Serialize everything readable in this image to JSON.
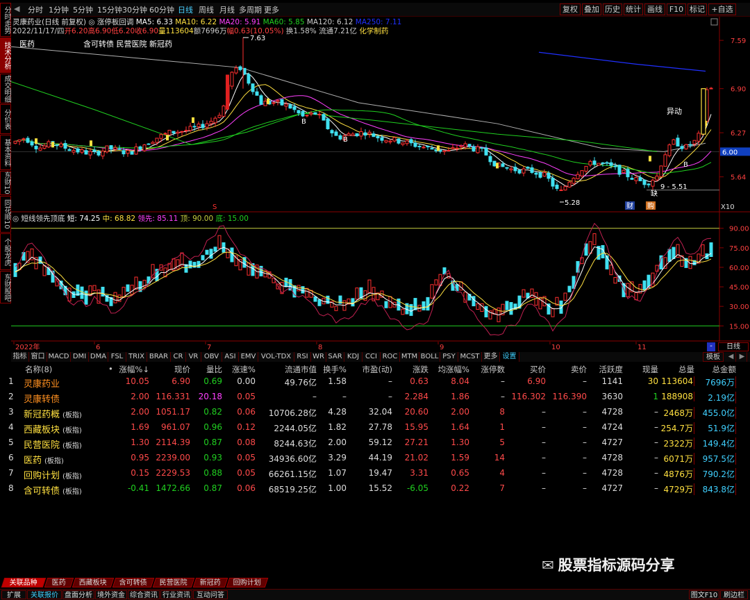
{
  "toolbar": {
    "periods": [
      "分时",
      "1分钟",
      "5分钟",
      "15分钟",
      "30分钟",
      "60分钟",
      "日线",
      "周线",
      "月线",
      "多周期",
      "更多"
    ],
    "active": "日线",
    "buttons": [
      "复权",
      "叠加",
      "历史",
      "统计",
      "画线",
      "F10",
      "标记",
      "+自选"
    ],
    "nav_back": "◀",
    "nav_fwd": "▶"
  },
  "left_tabs": [
    "分时走势",
    "技术分析",
    "成交明细",
    "分价表",
    "基本资料",
    "东财10",
    "同花顺10",
    "个股龙虎",
    "东财股吧"
  ],
  "left_tabs_active": 1,
  "chart_header": {
    "stock": "灵康药业(日线 前复权)",
    "indicator": "涨停板回调",
    "ma5": "MA5: 6.33",
    "ma10": "MA10: 6.22",
    "ma20": "MA20: 5.91",
    "ma60": "MA60: 5.85",
    "ma120": "MA120: 6.12",
    "ma250": "MA250: 7.11",
    "date": "2022/11/17/四",
    "open": "开6.20",
    "high": "高6.90",
    "low": "低6.20",
    "close": "收6.90",
    "vol": "量113604",
    "amount": "额7696万",
    "change": "幅0.63(10.05%)",
    "turnover": "换1.58%",
    "float": "流通7.21亿",
    "industry": "化学制药",
    "label_left": "医药",
    "label_concepts": "含可转债 民营医院 新冠药"
  },
  "price_axis": [
    "7.59",
    "6.90",
    "6.27",
    "5.64"
  ],
  "current_price": "6.00",
  "annotations": {
    "high": "7.63",
    "low": "5.28",
    "low2": "5.51",
    "low2_prefix": "9 -",
    "yidong": "异动",
    "cai": "财",
    "gou": "购",
    "que": "缺",
    "s": "S",
    "b1": "B",
    "b2": "B",
    "b3": "B",
    "x10": "X10"
  },
  "osc_header": {
    "name": "短线领先顶底",
    "short": "短: 74.25",
    "mid": "中: 68.82",
    "lead": "领先: 85.11",
    "top": "顶: 90.00",
    "bottom": "底: 15.00"
  },
  "osc_axis": [
    "90.00",
    "75.00",
    "60.00",
    "45.00",
    "30.00",
    "15.00"
  ],
  "date_axis": {
    "labels": [
      "2022年",
      "6",
      "7",
      "8",
      "9",
      "10",
      "11"
    ],
    "right_btn": "日线",
    "minus": "-"
  },
  "indicator_tabs": [
    "指标",
    "窗口",
    "MACD",
    "DMI",
    "DMA",
    "FSL",
    "TRIX",
    "BRAR",
    "CR",
    "VR",
    "OBV",
    "ASI",
    "EMV",
    "VOL-TDX",
    "RSI",
    "WR",
    "SAR",
    "KDJ",
    "CCI",
    "ROC",
    "MTM",
    "BOLL",
    "PSY",
    "MCST",
    "更多",
    "设置"
  ],
  "indicator_right": "模板",
  "table": {
    "headers": [
      "名称(8)",
      "•",
      "涨幅%↓",
      "现价",
      "量比",
      "涨速%",
      "流通市值",
      "换手%",
      "市盈(动)",
      "涨跌",
      "均涨幅%",
      "涨停数",
      "买价",
      "卖价",
      "活跃度",
      "现量",
      "总量",
      "总金额"
    ],
    "rows": [
      {
        "idx": "1",
        "name": "灵康药业",
        "tag": "",
        "chg": "10.05",
        "price": "6.90",
        "lb": "0.69",
        "spd": "0.00",
        "mcap": "49.76亿",
        "turn": "1.58",
        "pe": "–",
        "diff": "0.63",
        "avg": "8.04",
        "zt": "–",
        "bid": "6.90",
        "ask": "–",
        "act": "1141",
        "xl": "30",
        "vol": "113604",
        "amt": "7696万"
      },
      {
        "idx": "2",
        "name": "灵康转债",
        "tag": "",
        "chg": "2.00",
        "price": "116.331",
        "lb": "20.18",
        "spd": "0.05",
        "mcap": "–",
        "turn": "–",
        "pe": "–",
        "diff": "2.284",
        "avg": "1.86",
        "zt": "–",
        "bid": "116.302",
        "ask": "116.390",
        "act": "3630",
        "xl": "1",
        "vol": "188908",
        "amt": "2.19亿"
      },
      {
        "idx": "3",
        "name": "新冠药概",
        "tag": "(板指)",
        "chg": "2.00",
        "price": "1051.17",
        "lb": "0.82",
        "spd": "0.06",
        "mcap": "10706.28亿",
        "turn": "4.28",
        "pe": "32.04",
        "diff": "20.60",
        "avg": "2.00",
        "zt": "8",
        "bid": "–",
        "ask": "–",
        "act": "4728",
        "xl": "–",
        "vol": "2468万",
        "amt": "455.0亿"
      },
      {
        "idx": "4",
        "name": "西藏板块",
        "tag": "(板指)",
        "chg": "1.69",
        "price": "961.07",
        "lb": "0.96",
        "spd": "0.12",
        "mcap": "2244.05亿",
        "turn": "1.82",
        "pe": "27.78",
        "diff": "15.95",
        "avg": "1.64",
        "zt": "1",
        "bid": "–",
        "ask": "–",
        "act": "4724",
        "xl": "–",
        "vol": "254.7万",
        "amt": "51.9亿"
      },
      {
        "idx": "5",
        "name": "民营医院",
        "tag": "(板指)",
        "chg": "1.30",
        "price": "2114.39",
        "lb": "0.87",
        "spd": "0.08",
        "mcap": "8244.63亿",
        "turn": "2.00",
        "pe": "59.12",
        "diff": "27.21",
        "avg": "1.30",
        "zt": "5",
        "bid": "–",
        "ask": "–",
        "act": "4727",
        "xl": "–",
        "vol": "2322万",
        "amt": "149.4亿"
      },
      {
        "idx": "6",
        "name": "医药",
        "tag": "(板指)",
        "chg": "0.95",
        "price": "2239.00",
        "lb": "0.93",
        "spd": "0.05",
        "mcap": "34936.60亿",
        "turn": "3.29",
        "pe": "44.19",
        "diff": "21.02",
        "avg": "1.59",
        "zt": "14",
        "bid": "–",
        "ask": "–",
        "act": "4728",
        "xl": "–",
        "vol": "6071万",
        "amt": "957.5亿"
      },
      {
        "idx": "7",
        "name": "回购计划",
        "tag": "(板指)",
        "chg": "0.15",
        "price": "2229.53",
        "lb": "0.88",
        "spd": "0.05",
        "mcap": "66261.15亿",
        "turn": "1.07",
        "pe": "19.47",
        "diff": "3.31",
        "avg": "0.65",
        "zt": "4",
        "bid": "–",
        "ask": "–",
        "act": "4728",
        "xl": "–",
        "vol": "4876万",
        "amt": "790.2亿"
      },
      {
        "idx": "8",
        "name": "含可转债",
        "tag": "(板指)",
        "chg": "-0.41",
        "price": "1472.66",
        "lb": "0.87",
        "spd": "0.06",
        "mcap": "68519.25亿",
        "turn": "1.00",
        "pe": "15.52",
        "diff": "-6.05",
        "avg": "0.22",
        "zt": "7",
        "bid": "–",
        "ask": "–",
        "act": "4727",
        "xl": "–",
        "vol": "4729万",
        "amt": "843.8亿"
      }
    ]
  },
  "bottom_tabs": [
    "关联品种",
    "医药",
    "西藏板块",
    "含可转债",
    "民营医院",
    "新冠药",
    "回购计划"
  ],
  "bottom_bar": [
    "扩展",
    "关联报价",
    "盘面分析",
    "境外资金",
    "综合资讯",
    "行业资讯",
    "互动问答"
  ],
  "bottom_right": [
    "图文F10",
    "刷边栏"
  ],
  "watermark": "股票指标源码分享",
  "colors": {
    "up": "#ff3030",
    "down": "#40e0f0",
    "ma5": "#ffffff",
    "ma10": "#ffe040",
    "ma20": "#ff40ff",
    "ma60": "#20d020",
    "ma120": "#b0b0b0",
    "ma250": "#2030ff",
    "border": "#8a0000"
  }
}
